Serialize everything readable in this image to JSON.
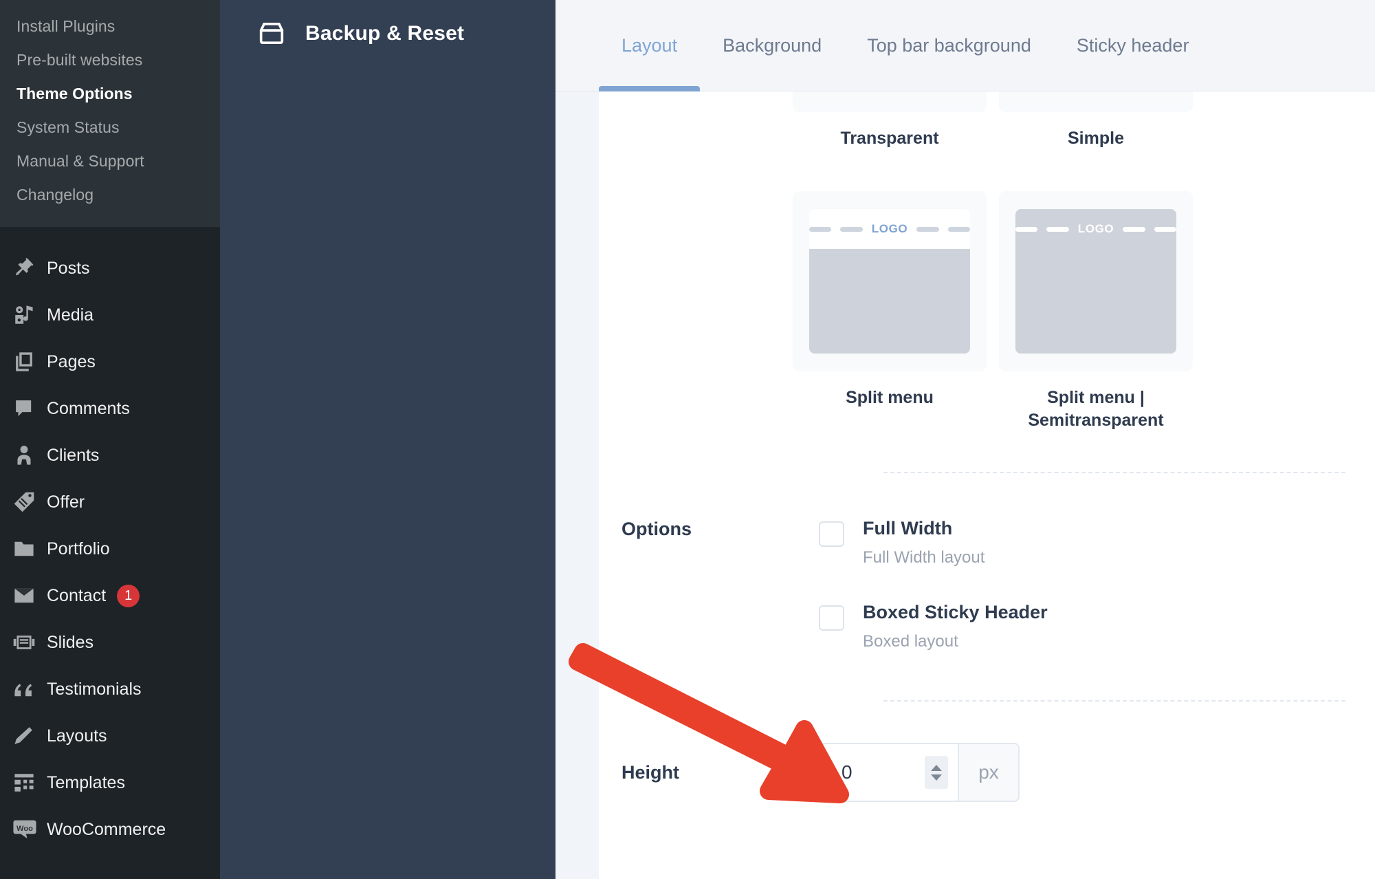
{
  "wp_sidebar": {
    "submenu": [
      {
        "label": "Install Plugins",
        "current": false
      },
      {
        "label": "Pre-built websites",
        "current": false
      },
      {
        "label": "Theme Options",
        "current": true
      },
      {
        "label": "System Status",
        "current": false
      },
      {
        "label": "Manual & Support",
        "current": false
      },
      {
        "label": "Changelog",
        "current": false
      }
    ],
    "menu": [
      {
        "label": "Posts",
        "icon": "pin-icon",
        "badge": null
      },
      {
        "label": "Media",
        "icon": "media-icon",
        "badge": null
      },
      {
        "label": "Pages",
        "icon": "pages-icon",
        "badge": null
      },
      {
        "label": "Comments",
        "icon": "comment-icon",
        "badge": null
      },
      {
        "label": "Clients",
        "icon": "user-icon",
        "badge": null
      },
      {
        "label": "Offer",
        "icon": "tag-icon",
        "badge": null
      },
      {
        "label": "Portfolio",
        "icon": "portfolio-icon",
        "badge": null
      },
      {
        "label": "Contact",
        "icon": "mail-icon",
        "badge": "1"
      },
      {
        "label": "Slides",
        "icon": "slides-icon",
        "badge": null
      },
      {
        "label": "Testimonials",
        "icon": "quote-icon",
        "badge": null
      },
      {
        "label": "Layouts",
        "icon": "pencil-icon",
        "badge": null
      },
      {
        "label": "Templates",
        "icon": "grid-icon",
        "badge": null
      },
      {
        "label": "WooCommerce",
        "icon": "woo-icon",
        "badge": null
      }
    ]
  },
  "options_panel": {
    "title": "Backup & Reset",
    "icon": "archive-box-icon"
  },
  "tabs": [
    {
      "label": "Layout",
      "active": true
    },
    {
      "label": "Background",
      "active": false
    },
    {
      "label": "Top bar background",
      "active": false
    },
    {
      "label": "Sticky header",
      "active": false
    }
  ],
  "header_layouts": {
    "row1_captions": [
      "Transparent",
      "Simple"
    ],
    "row2": [
      {
        "caption": "Split menu",
        "logo_text": "LOGO",
        "bar_background": "#ffffff",
        "logo_color": "#7fa4d4",
        "dash_color": "#ced5de",
        "body_color": "#ced3db"
      },
      {
        "caption": "Split menu | Semitransparent",
        "logo_text": "LOGO",
        "bar_background": "#ced3db",
        "logo_color": "#ffffff",
        "dash_color": "#ffffff",
        "body_color": "#ced3db"
      }
    ]
  },
  "options_row": {
    "label": "Options",
    "items": [
      {
        "title": "Full Width",
        "subtitle": "Full Width layout",
        "checked": false
      },
      {
        "title": "Boxed Sticky Header",
        "subtitle": "Boxed layout",
        "checked": false
      }
    ]
  },
  "height_row": {
    "label": "Height",
    "value": "0",
    "unit": "px"
  },
  "colors": {
    "accent": "#7fa4d4",
    "annotation": "#e8402a",
    "wp_dark": "#1d2327",
    "panel_dark": "#333f52",
    "badge_red": "#d63638"
  },
  "annotation": {
    "shape": "red-arrow",
    "points_to": "height-input"
  }
}
